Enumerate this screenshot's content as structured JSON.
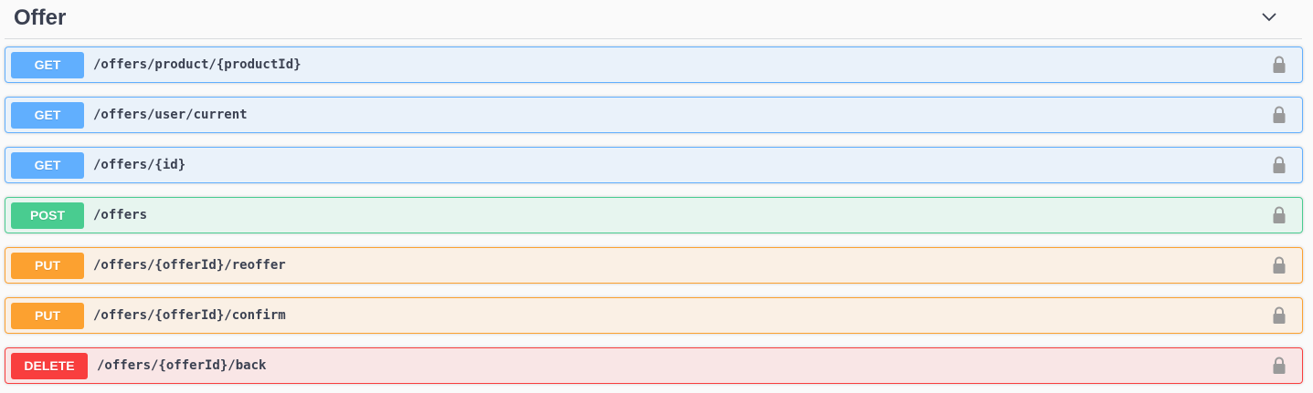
{
  "tag": {
    "title": "Offer",
    "collapse_icon": "chevron-down-icon"
  },
  "operations": [
    {
      "method": "GET",
      "path": "/offers/product/{productId}",
      "icon": "lock-icon"
    },
    {
      "method": "GET",
      "path": "/offers/user/current",
      "icon": "lock-icon"
    },
    {
      "method": "GET",
      "path": "/offers/{id}",
      "icon": "lock-icon"
    },
    {
      "method": "POST",
      "path": "/offers",
      "icon": "lock-icon"
    },
    {
      "method": "PUT",
      "path": "/offers/{offerId}/reoffer",
      "icon": "lock-icon"
    },
    {
      "method": "PUT",
      "path": "/offers/{offerId}/confirm",
      "icon": "lock-icon"
    },
    {
      "method": "DELETE",
      "path": "/offers/{offerId}/back",
      "icon": "lock-icon"
    }
  ],
  "colors": {
    "get": "#61affe",
    "post": "#49cc90",
    "put": "#fca130",
    "delete": "#f93e3e",
    "text": "#3b4151"
  }
}
